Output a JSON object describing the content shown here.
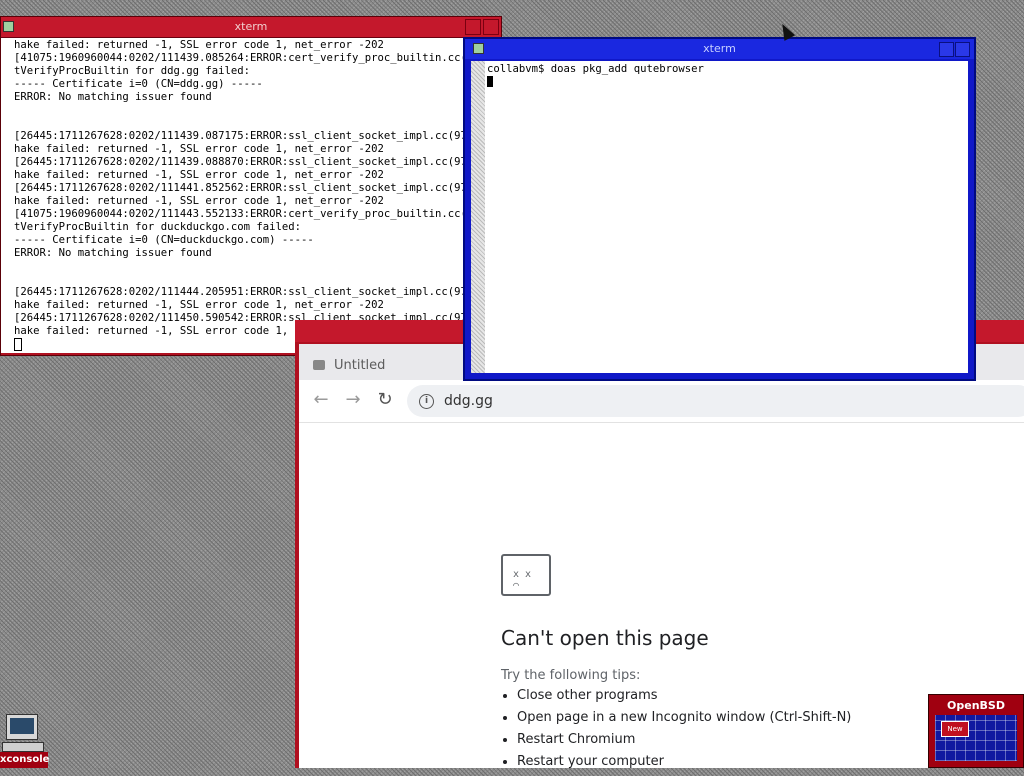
{
  "xterm_left": {
    "title": "xterm",
    "lines": [
      "hake failed: returned -1, SSL error code 1, net_error -202",
      "[41075:1960960044:0202/111439.085264:ERROR:cert_verify_proc_builtin.cc(705)",
      "tVerifyProcBuiltin for ddg.gg failed:",
      "----- Certificate i=0 (CN=ddg.gg) -----",
      "ERROR: No matching issuer found",
      "",
      "",
      "[26445:1711267628:0202/111439.087175:ERROR:ssl_client_socket_impl.cc(975)]",
      "hake failed: returned -1, SSL error code 1, net_error -202",
      "[26445:1711267628:0202/111439.088870:ERROR:ssl_client_socket_impl.cc(975)]",
      "hake failed: returned -1, SSL error code 1, net_error -202",
      "[26445:1711267628:0202/111441.852562:ERROR:ssl_client_socket_impl.cc(975)]",
      "hake failed: returned -1, SSL error code 1, net_error -202",
      "[41075:1960960044:0202/111443.552133:ERROR:cert_verify_proc_builtin.cc(705)",
      "tVerifyProcBuiltin for duckduckgo.com failed:",
      "----- Certificate i=0 (CN=duckduckgo.com) -----",
      "ERROR: No matching issuer found",
      "",
      "",
      "[26445:1711267628:0202/111444.205951:ERROR:ssl_client_socket_impl.cc(975)]",
      "hake failed: returned -1, SSL error code 1, net_error -202",
      "[26445:1711267628:0202/111450.590542:ERROR:ssl_client_socket_impl.cc(975)]",
      "hake failed: returned -1, SSL error code 1, net_error -202"
    ]
  },
  "xterm_right": {
    "title": "xterm",
    "prompt_line": "collabvm$ doas pkg_add qutebrowser"
  },
  "browser": {
    "tab_title": "Untitled",
    "url": "ddg.gg",
    "error": {
      "heading": "Can't open this page",
      "tips_label": "Try the following tips:",
      "tips": [
        "Close other programs",
        "Open page in a new Incognito window (Ctrl-Shift-N)",
        "Restart Chromium",
        "Restart your computer"
      ]
    }
  },
  "desktop": {
    "xconsole_label": "xconsole",
    "pager_title": "OpenBSD",
    "pager_window_label": "New"
  }
}
